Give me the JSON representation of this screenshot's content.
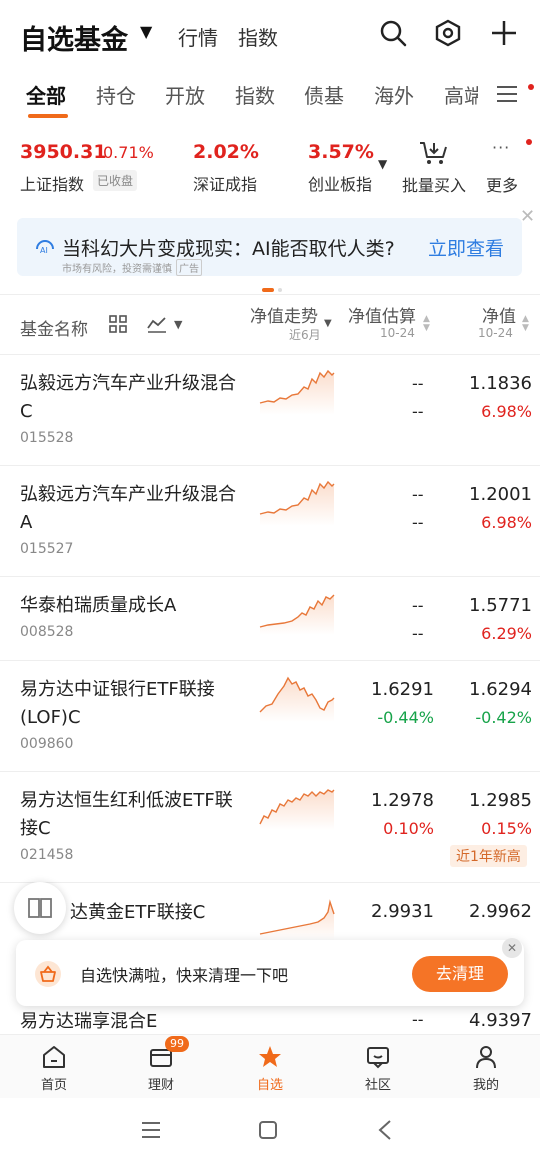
{
  "header": {
    "title": "自选基金",
    "nav": [
      "行情",
      "指数"
    ]
  },
  "tabs": [
    "全部",
    "持仓",
    "开放",
    "指数",
    "债基",
    "海外",
    "高端"
  ],
  "indices": [
    {
      "value": "3950.31",
      "change": "0.71%",
      "name": "上证指数",
      "status": "已收盘"
    },
    {
      "value": "2.02%",
      "name": "深证成指"
    },
    {
      "value": "3.57%",
      "name": "创业板指"
    }
  ],
  "tools": {
    "batch_buy": "批量买入",
    "more": "更多",
    "more_dots": "···"
  },
  "banner": {
    "text": "当科幻大片变成现实：AI能否取代人类?",
    "link": "立即查看",
    "note": "市场有风险，投资需谨慎",
    "ad": "广告"
  },
  "columns": {
    "name": "基金名称",
    "trend": "净值走势",
    "trend_sub": "近6月",
    "estimate": "净值估算",
    "estimate_sub": "10-24",
    "nav": "净值",
    "nav_sub": "10-24"
  },
  "funds": [
    {
      "name": "弘毅远方汽车产业升级混合C",
      "code": "015528",
      "est": "--",
      "est_chg": "--",
      "nav": "1.1836",
      "nav_chg": "6.98%"
    },
    {
      "name": "弘毅远方汽车产业升级混合A",
      "code": "015527",
      "est": "--",
      "est_chg": "--",
      "nav": "1.2001",
      "nav_chg": "6.98%"
    },
    {
      "name": "华泰柏瑞质量成长A",
      "code": "008528",
      "est": "--",
      "est_chg": "--",
      "nav": "1.5771",
      "nav_chg": "6.29%"
    },
    {
      "name": "易方达中证银行ETF联接(LOF)C",
      "code": "009860",
      "est": "1.6291",
      "est_chg": "-0.44%",
      "nav": "1.6294",
      "nav_chg": "-0.42%"
    },
    {
      "name": "易方达恒生红利低波ETF联接C",
      "code": "021458",
      "est": "1.2978",
      "est_chg": "0.10%",
      "nav": "1.2985",
      "nav_chg": "0.15%",
      "tag": "近1年新高"
    },
    {
      "name": "达黄金ETF联接C",
      "code": "",
      "est": "2.9931",
      "est_chg": "",
      "nav": "2.9962",
      "nav_chg": ""
    },
    {
      "name": "易方达瑞享混合E",
      "code": "",
      "est": "--",
      "est_chg": "",
      "nav": "4.9397",
      "nav_chg": ""
    }
  ],
  "toast": {
    "text": "自选快满啦，快来清理一下吧",
    "button": "去清理"
  },
  "bottom_nav": [
    "首页",
    "理财",
    "自选",
    "社区",
    "我的"
  ],
  "badge": "99",
  "colors": {
    "accent": "#f06a1a",
    "up": "#e0231e",
    "down": "#17a34a"
  }
}
